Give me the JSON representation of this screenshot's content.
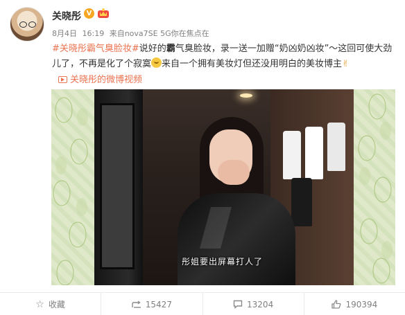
{
  "author": {
    "name": "关晓彤",
    "verify_mark": "V"
  },
  "meta": {
    "date": "8月4日",
    "time": "16:19",
    "source_prefix": "来自",
    "source": "nova7SE 5G你在焦点在"
  },
  "content": {
    "topic": "#关晓彤霸气臭脸妆#",
    "text1": "说好的",
    "bold_word": "霸",
    "text2": "气臭脸妆，录一送一加赠“奶凶奶凶妆”～这回可使大劲儿了，不再是化了个寂寞",
    "text3": "来自一个拥有美妆灯但还没用明白的美妆博主"
  },
  "video_link": {
    "label": "关晓彤的微博视频"
  },
  "video": {
    "subtitle": "彤姐要出屏幕打人了"
  },
  "toolbar": {
    "favorite_label": "收藏",
    "repost_count": "15427",
    "comment_count": "13204",
    "like_count": "190394"
  },
  "icons": {
    "favorite": "star-icon",
    "repost": "repost-icon",
    "comment": "comment-icon",
    "like": "thumbs-up-icon"
  },
  "colors": {
    "topic": "#eb7350",
    "meta": "#808080",
    "text": "#333333"
  }
}
